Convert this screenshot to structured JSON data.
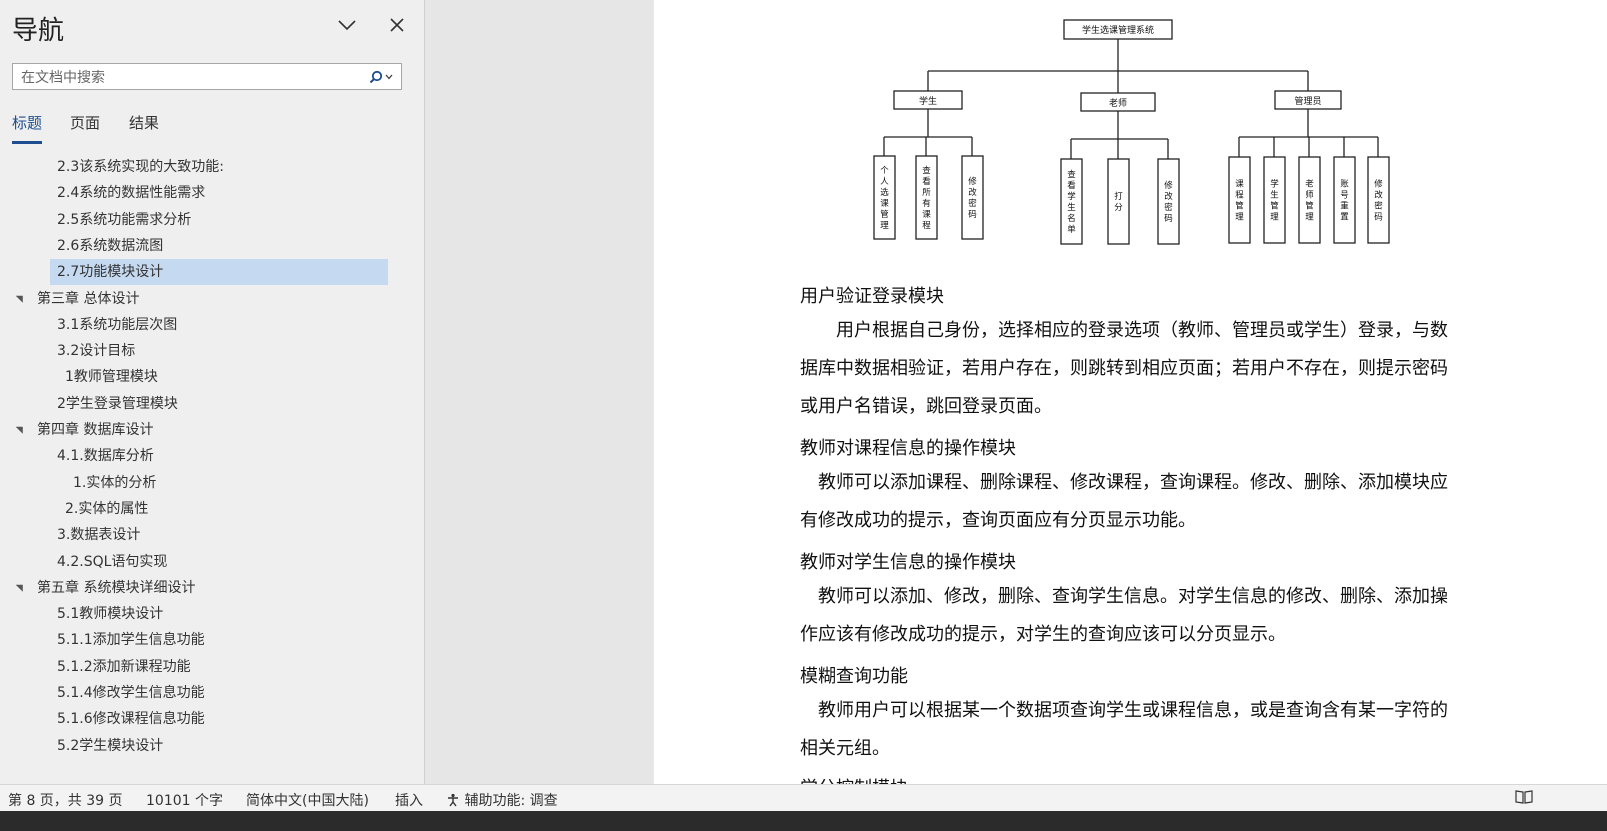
{
  "nav": {
    "title": "导航",
    "search_placeholder": "在文档中搜索",
    "tabs": [
      "标题",
      "页面",
      "结果"
    ],
    "outline": [
      {
        "text": "2.3该系统实现的大致功能:",
        "level": 2
      },
      {
        "text": "2.4系统的数据性能需求",
        "level": 2
      },
      {
        "text": "2.5系统功能需求分析",
        "level": 2
      },
      {
        "text": "2.6系统数据流图",
        "level": 2
      },
      {
        "text": "2.7功能模块设计",
        "level": 2,
        "selected": true
      },
      {
        "text": "第三章  总体设计",
        "level": 1,
        "expanded": true
      },
      {
        "text": "3.1系统功能层次图",
        "level": 2
      },
      {
        "text": "3.2设计目标",
        "level": 2
      },
      {
        "text": "1教师管理模块",
        "level": 3
      },
      {
        "text": "2学生登录管理模块",
        "level": 2
      },
      {
        "text": "第四章  数据库设计",
        "level": 1,
        "expanded": true
      },
      {
        "text": "4.1.数据库分析",
        "level": 2
      },
      {
        "text": "1.实体的分析",
        "level": 4
      },
      {
        "text": "2.实体的属性",
        "level": 3
      },
      {
        "text": "3.数据表设计",
        "level": 2
      },
      {
        "text": "4.2.SQL语句实现",
        "level": 2
      },
      {
        "text": "第五章  系统模块详细设计",
        "level": 1,
        "expanded": true
      },
      {
        "text": "5.1教师模块设计",
        "level": 2
      },
      {
        "text": "5.1.1添加学生信息功能",
        "level": 2
      },
      {
        "text": "5.1.2添加新课程功能",
        "level": 2
      },
      {
        "text": "5.1.4修改学生信息功能",
        "level": 2
      },
      {
        "text": "5.1.6修改课程信息功能",
        "level": 2
      },
      {
        "text": "5.2学生模块设计",
        "level": 2
      }
    ]
  },
  "diagram": {
    "root": "学生选课管理系统",
    "branches": [
      {
        "label": "学生",
        "children": [
          "个人选课管理",
          "查看所有课程",
          "修改密码"
        ]
      },
      {
        "label": "老师",
        "children": [
          "查看学生名单",
          "打分",
          "修改密码"
        ]
      },
      {
        "label": "管理员",
        "children": [
          "课程管理",
          "学生管理",
          "老师管理",
          "账号重置",
          "修改密码"
        ]
      }
    ]
  },
  "document": {
    "h1": "用户验证登录模块",
    "p1": "用户根据自己身份，选择相应的登录选项（教师、管理员或学生）登录，与数据库中数据相验证，若用户存在，则跳转到相应页面；若用户不存在，则提示密码或用户名错误，跳回登录页面。",
    "h2": "教师对课程信息的操作模块",
    "p2": "教师可以添加课程、删除课程、修改课程，查询课程。修改、删除、添加模块应有修改成功的提示，查询页面应有分页显示功能。",
    "h3": "教师对学生信息的操作模块",
    "p3": "教师可以添加、修改，删除、查询学生信息。对学生信息的修改、删除、添加操作应该有修改成功的提示，对学生的查询应该可以分页显示。",
    "h4": "模糊查询功能",
    "p4": "教师用户可以根据某一个数据项查询学生或课程信息，或是查询含有某一字符的相关元组。",
    "h5": "学分控制模块"
  },
  "status": {
    "page": "第 8 页，共 39 页",
    "words": "10101 个字",
    "language": "简体中文(中国大陆)",
    "mode": "插入",
    "accessibility": "辅助功能: 调查"
  }
}
